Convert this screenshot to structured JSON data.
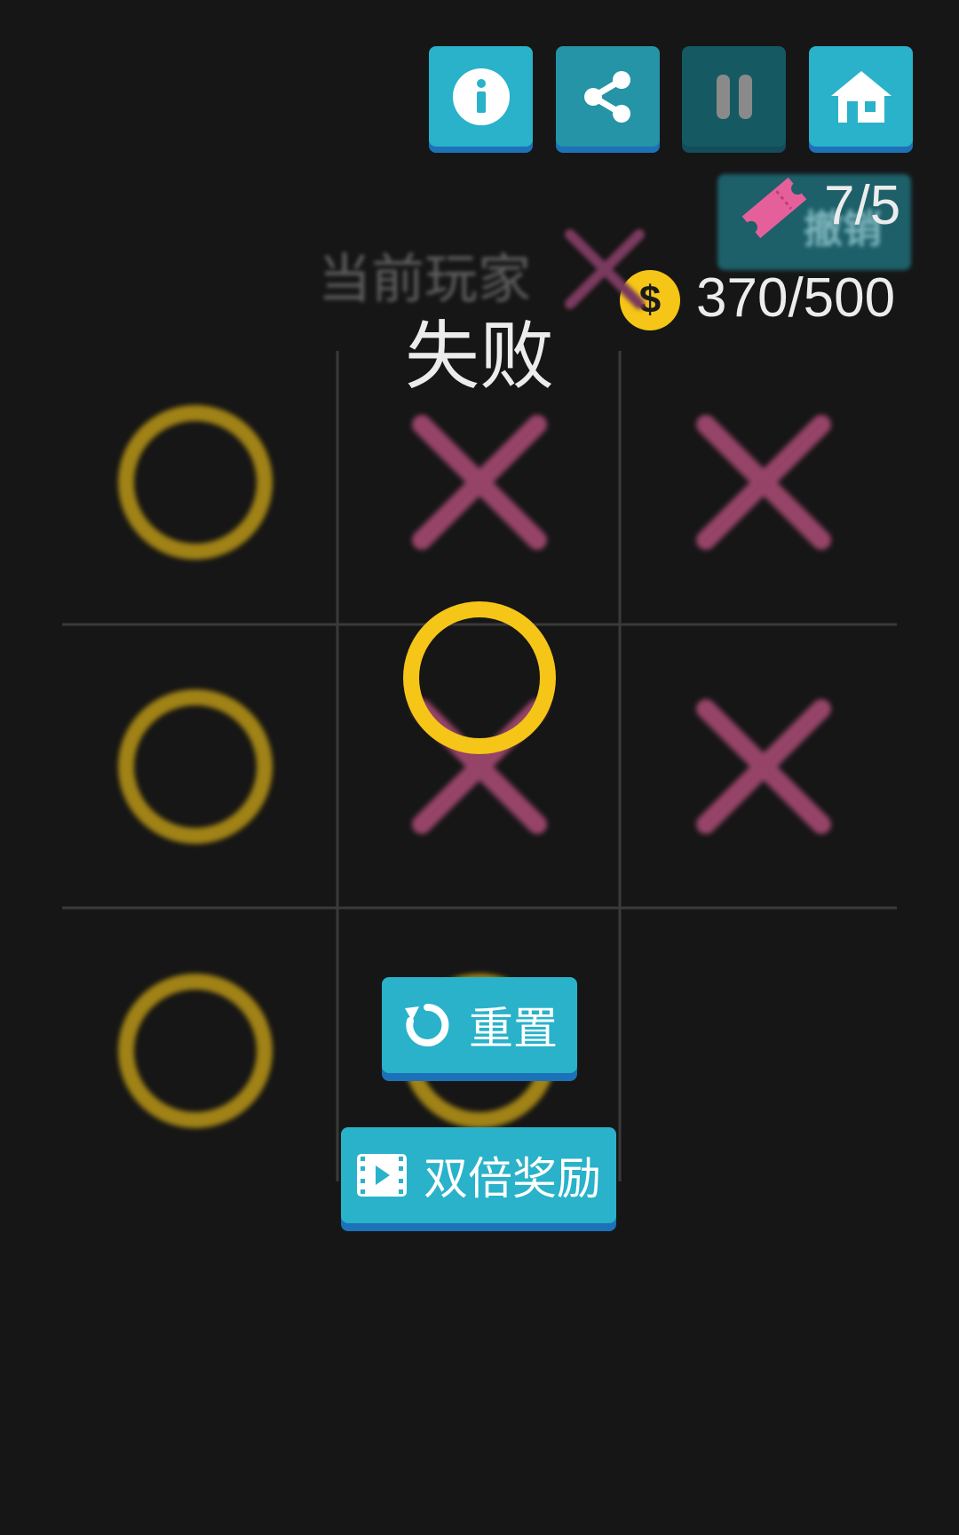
{
  "toolbar": {
    "info_icon": "info-icon",
    "share_icon": "share-icon",
    "pause_icon": "pause-icon",
    "home_icon": "home-icon"
  },
  "undo": {
    "label": "撤销",
    "count": "7/5",
    "icon": "ticket-icon",
    "icon_color": "#e5609b"
  },
  "coins": {
    "count": "370/500",
    "icon": "coin-icon",
    "symbol": "$",
    "icon_color": "#f5c518"
  },
  "current_player": {
    "label": "当前玩家",
    "mark": "X"
  },
  "result": {
    "text": "失败"
  },
  "board": {
    "cells": [
      [
        "O",
        "X",
        "X"
      ],
      [
        "O",
        "X",
        "X"
      ],
      [
        "O",
        "O",
        ""
      ]
    ],
    "last_move": {
      "mark": "O"
    },
    "winning_line": "left-column",
    "colors": {
      "o": "#f5c518",
      "x": "#e5609b",
      "grid": "#3a3a3a"
    }
  },
  "actions": {
    "reset_label": "重置",
    "reset_icon": "refresh-icon",
    "double_label": "双倍奖励",
    "double_icon": "video-icon"
  }
}
